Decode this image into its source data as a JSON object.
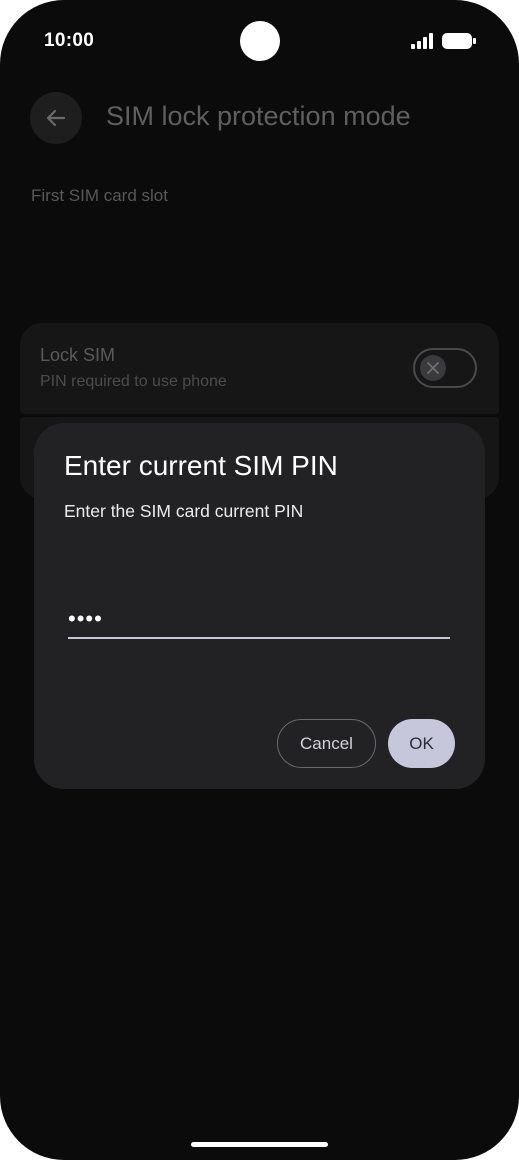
{
  "status_bar": {
    "time": "10:00"
  },
  "header": {
    "title": "SIM lock protection mode",
    "back_icon": "arrow-left-icon"
  },
  "section": {
    "label": "First SIM card slot"
  },
  "lock_sim": {
    "title": "Lock SIM",
    "subtitle": "PIN required to use phone",
    "toggle_state": "off"
  },
  "dialog": {
    "title": "Enter current SIM PIN",
    "message": "Enter the SIM card current PIN",
    "pin_value": "••••",
    "cancel_label": "Cancel",
    "ok_label": "OK"
  },
  "colors": {
    "background": "#0b0b0b",
    "dialog": "#222225",
    "accent": "#c6c7da"
  }
}
